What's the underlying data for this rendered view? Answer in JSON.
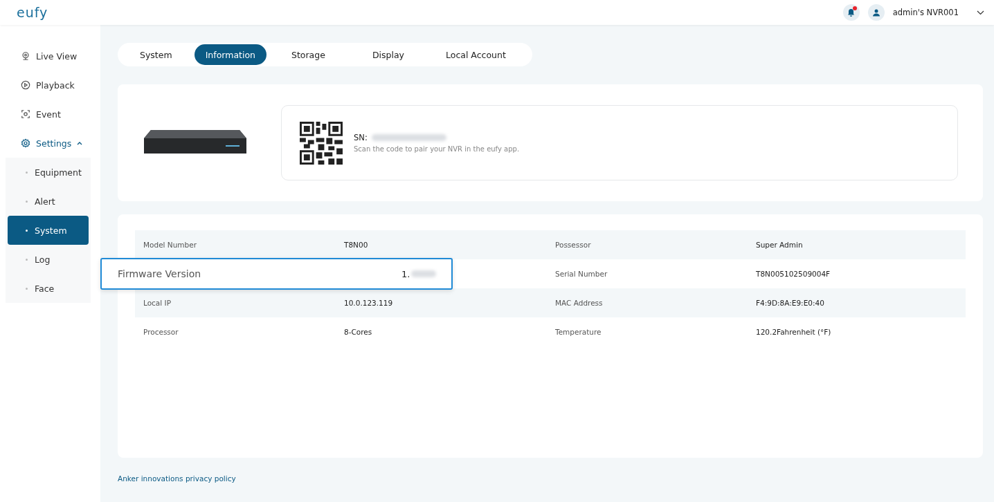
{
  "header": {
    "logo": "eufy",
    "notification": {
      "unread": true
    },
    "account": "admin's NVR001"
  },
  "sidebar": {
    "items": [
      {
        "label": "Live View",
        "selected": false
      },
      {
        "label": "Playback",
        "selected": false
      },
      {
        "label": "Event",
        "selected": false
      },
      {
        "label": "Settings",
        "selected": false,
        "expanded": true,
        "children": [
          {
            "label": "Equipment",
            "selected": false
          },
          {
            "label": "Alert",
            "selected": false
          },
          {
            "label": "System",
            "selected": true
          },
          {
            "label": "Log",
            "selected": false
          },
          {
            "label": "Face",
            "selected": false
          }
        ]
      }
    ]
  },
  "tabs": [
    {
      "label": "System",
      "selected": false
    },
    {
      "label": "Information",
      "selected": true
    },
    {
      "label": "Storage",
      "selected": false
    },
    {
      "label": "Display",
      "selected": false
    },
    {
      "label": "Local Account",
      "selected": false
    }
  ],
  "device": {
    "sn_label": "SN:",
    "hint": "Scan the code to pair your NVR in the eufy app."
  },
  "info_rows": [
    [
      {
        "label": "Model Number",
        "value": "T8N00"
      },
      {
        "label": "Possessor",
        "value": "Super Admin"
      }
    ],
    [
      {
        "label": "Firmware Version",
        "value": "1.",
        "highlighted": true
      },
      {
        "label": "Serial Number",
        "value": "T8N005102509004F"
      }
    ],
    [
      {
        "label": "Local IP",
        "value": "10.0.123.119"
      },
      {
        "label": "MAC Address",
        "value": "F4:9D:8A:E9:E0:40"
      }
    ],
    [
      {
        "label": "Processor",
        "value": "8-Cores"
      },
      {
        "label": "Temperature",
        "value": "120.2Fahrenheit (°F)"
      }
    ]
  ],
  "footer": {
    "link": "Anker innovations privacy policy"
  }
}
